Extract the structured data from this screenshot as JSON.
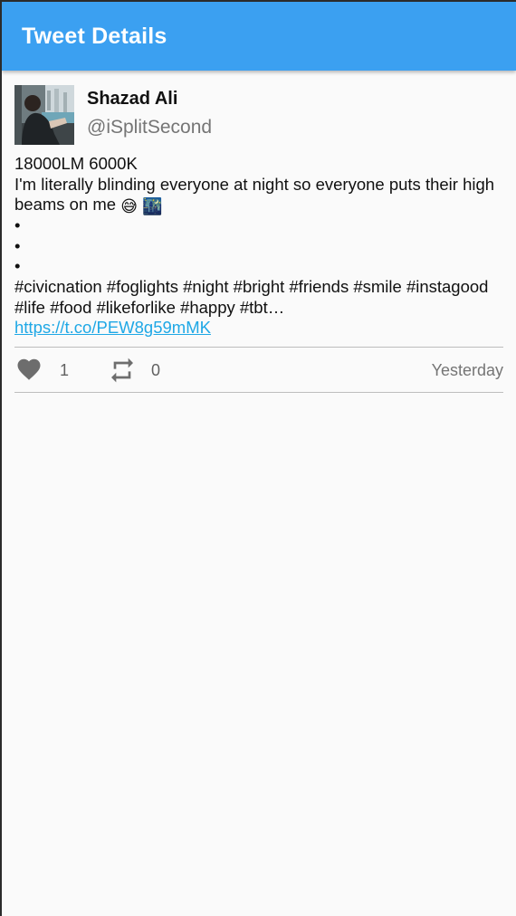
{
  "app_bar": {
    "title": "Tweet Details",
    "color": "#3ba0f1"
  },
  "tweet": {
    "author": {
      "name": "Shazad Ali",
      "handle": "@iSplitSecond",
      "avatar": "profile-photo"
    },
    "text_lines": [
      "18000LM 6000K",
      "I'm literally blinding everyone at night so everyone puts their high beams on me",
      "•",
      "•",
      "•",
      "#civicnation #foglights #night #bright #friends #smile #instagood #life #food #likeforlike #happy #tbt…"
    ],
    "emojis": [
      "😅",
      "🌃"
    ],
    "link": "https://t.co/PEW8g59mMK",
    "link_color": "#1fa8e6",
    "likes": "1",
    "retweets": "0",
    "timestamp": "Yesterday",
    "icons": {
      "like": "heart-icon",
      "retweet": "retweet-icon"
    }
  }
}
